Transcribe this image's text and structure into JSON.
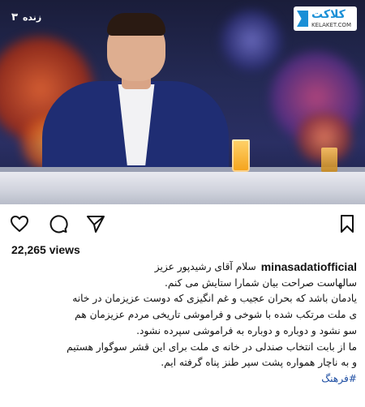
{
  "video": {
    "channel_logo": "۳",
    "live_label": "زنده",
    "brand_title": "کلاکت",
    "brand_subtitle": "KELAKET.COM"
  },
  "actions": {
    "like_icon": "heart-icon",
    "comment_icon": "comment-icon",
    "share_icon": "send-icon",
    "save_icon": "bookmark-icon"
  },
  "views": "22,265 views",
  "caption": {
    "username": "minasadatiofficial",
    "greeting": "سلام آقای رشیدپور عزیز",
    "line1": "سالهاست صراحت بیان شمارا ستایش می کنم.",
    "line2": "یادمان باشد که بحران عجیب و غم انگیزی که دوست عزیزمان در خانه",
    "line3": "ی ملت مرتکب شده با شوخی و فراموشی تاریخی مردم عزیزمان هم",
    "line4": "سو نشود و دوباره و دوباره به فراموشی سپرده نشود.",
    "line5": "ما از بابت انتخاب صندلی در خانه ی ملت برای این قشر سوگوار هستیم",
    "line6": "و به ناچار همواره پشت سپر طنز پناه گرفته ایم.",
    "hashtag": "#فرهنگ"
  }
}
